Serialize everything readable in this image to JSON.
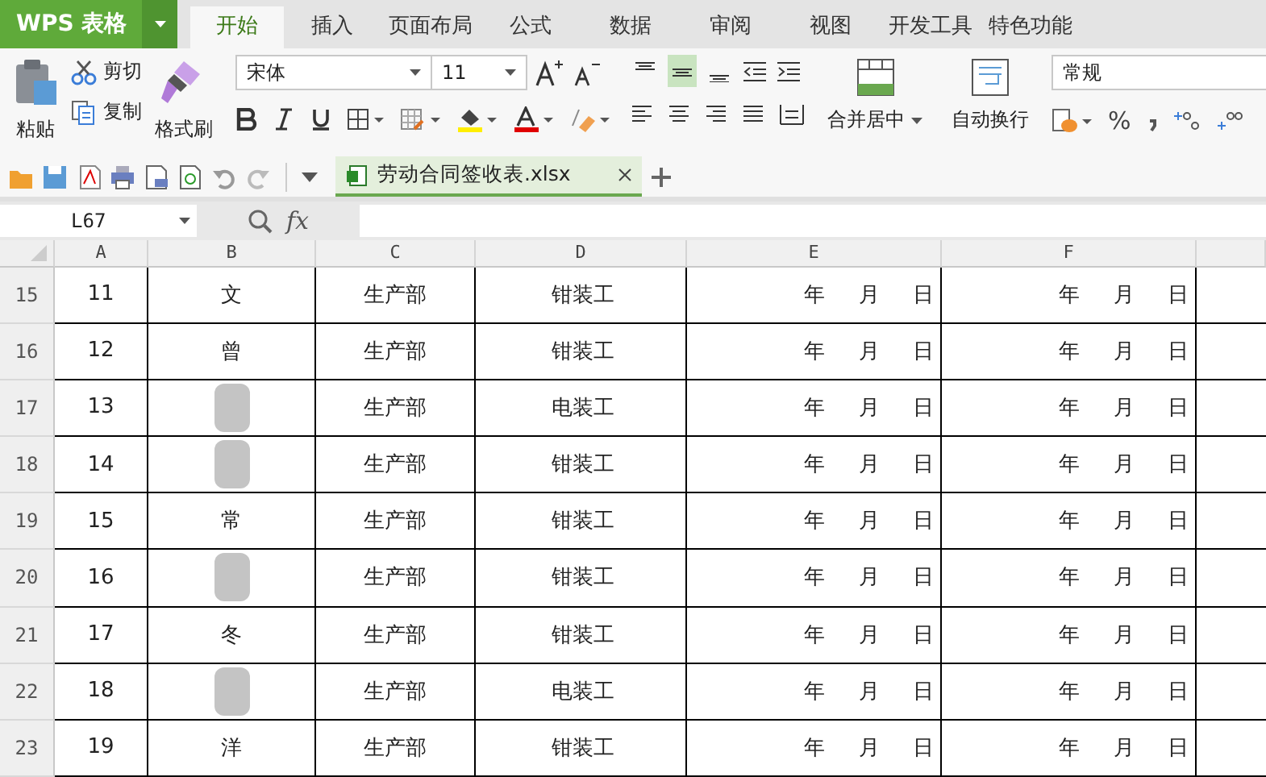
{
  "app": {
    "logo": "WPS 表格"
  },
  "tabs": [
    {
      "label": "开始",
      "selected": true
    },
    {
      "label": "插入",
      "selected": false
    },
    {
      "label": "页面布局",
      "selected": false
    },
    {
      "label": "公式",
      "selected": false
    },
    {
      "label": "数据",
      "selected": false
    },
    {
      "label": "审阅",
      "selected": false
    },
    {
      "label": "视图",
      "selected": false
    },
    {
      "label": "开发工具",
      "selected": false
    },
    {
      "label": "特色功能",
      "selected": false
    }
  ],
  "ribbon": {
    "paste": "粘贴",
    "cut": "剪切",
    "copy": "复制",
    "format_painter": "格式刷",
    "font_name": "宋体",
    "font_size": "11",
    "merge": "合并居中",
    "wrap": "自动换行",
    "number_format": "常规",
    "percent": "%",
    "vertical_align": [
      {
        "selected": false
      },
      {
        "selected": true
      },
      {
        "selected": false
      }
    ]
  },
  "file_tabs": [
    {
      "name": "劳动合同签收表.xlsx",
      "selected": true
    }
  ],
  "name_box": "L67",
  "fx_label": "fx",
  "columns": [
    "A",
    "B",
    "C",
    "D",
    "E",
    "F"
  ],
  "rows": [
    {
      "row": "15",
      "no": "11",
      "name": "文",
      "dept": "生产部",
      "job": "钳装工",
      "date_e": "年     月     日",
      "date_f": "年     月     日"
    },
    {
      "row": "16",
      "no": "12",
      "name": "曾",
      "dept": "生产部",
      "job": "钳装工",
      "date_e": "年     月     日",
      "date_f": "年     月     日"
    },
    {
      "row": "17",
      "no": "13",
      "dept": "生产部",
      "job": "电装工",
      "date_e": "年     月     日",
      "date_f": "年     月     日"
    },
    {
      "row": "18",
      "no": "14",
      "dept": "生产部",
      "job": "钳装工",
      "date_e": "年     月     日",
      "date_f": "年     月     日"
    },
    {
      "row": "19",
      "no": "15",
      "name": "常",
      "dept": "生产部",
      "job": "钳装工",
      "date_e": "年     月     日",
      "date_f": "年     月     日"
    },
    {
      "row": "20",
      "no": "16",
      "dept": "生产部",
      "job": "钳装工",
      "date_e": "年     月     日",
      "date_f": "年     月     日"
    },
    {
      "row": "21",
      "no": "17",
      "name": "冬",
      "dept": "生产部",
      "job": "钳装工",
      "date_e": "年     月     日",
      "date_f": "年     月     日"
    },
    {
      "row": "22",
      "no": "18",
      "dept": "生产部",
      "job": "电装工",
      "date_e": "年     月     日",
      "date_f": "年     月     日"
    },
    {
      "row": "23",
      "no": "19",
      "name": "洋",
      "dept": "生产部",
      "job": "钳装工",
      "date_e": "年     月     日",
      "date_f": "年     月     日"
    }
  ]
}
